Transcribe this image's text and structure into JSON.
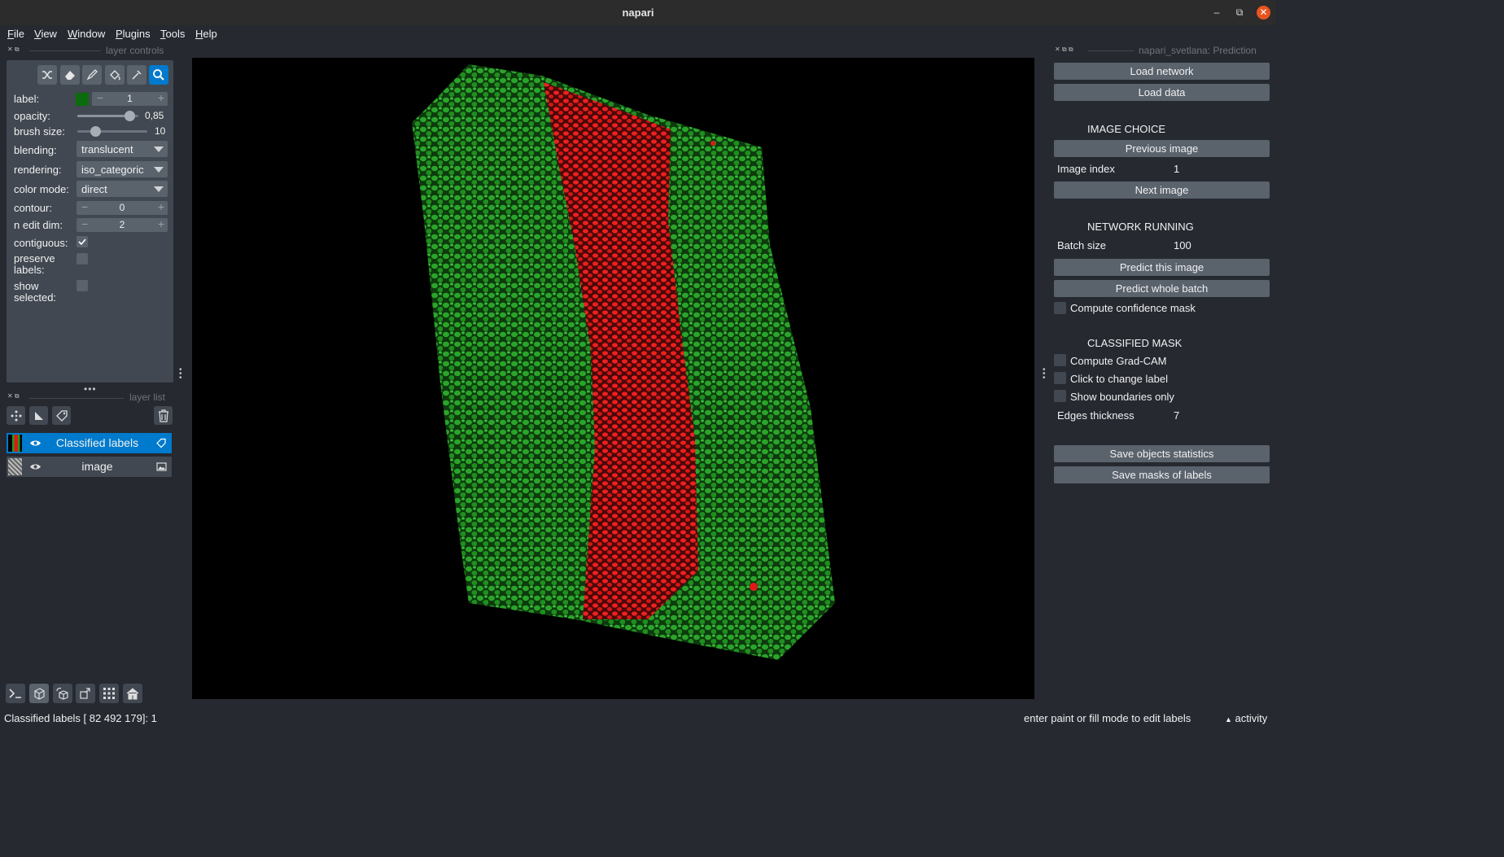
{
  "window": {
    "title": "napari"
  },
  "menu": [
    "File",
    "View",
    "Window",
    "Plugins",
    "Tools",
    "Help"
  ],
  "left_dock": {
    "controls_header": "layer controls",
    "list_header": "layer list"
  },
  "layer_controls": {
    "label_text": "label:",
    "label_value": "1",
    "label_color": "#0c6b0c",
    "opacity_text": "opacity:",
    "opacity_value": "0,85",
    "opacity_level": 0.85,
    "brush_text": "brush size:",
    "brush_value": "10",
    "blending_text": "blending:",
    "blending_value": "translucent",
    "rendering_text": "rendering:",
    "rendering_value": "iso_categoric",
    "color_mode_text": "color mode:",
    "color_mode_value": "direct",
    "contour_text": "contour:",
    "contour_value": "0",
    "n_edit_dim_text": "n edit dim:",
    "n_edit_dim_value": "2",
    "contiguous_text": "contiguous:",
    "contiguous_checked": true,
    "preserve_text_1": "preserve",
    "preserve_text_2": "labels:",
    "show_text_1": "show",
    "show_text_2": "selected:"
  },
  "layers": [
    {
      "name": "Classified labels",
      "selected": true,
      "icon": "label-tag-icon"
    },
    {
      "name": "image",
      "selected": false,
      "icon": "image-icon"
    }
  ],
  "right_dock": {
    "header": "napari_svetlana: Prediction",
    "load_network": "Load network",
    "load_data": "Load data",
    "image_choice": "IMAGE CHOICE",
    "previous_image": "Previous image",
    "image_index_label": "Image index",
    "image_index_value": "1",
    "next_image": "Next image",
    "network_running": "NETWORK RUNNING",
    "batch_size_label": "Batch size",
    "batch_size_value": "100",
    "predict_image": "Predict this image",
    "predict_batch": "Predict whole batch",
    "confidence_mask": "Compute confidence mask",
    "classified_mask": "CLASSIFIED MASK",
    "grad_cam": "Compute Grad-CAM",
    "click_change": "Click to change label",
    "show_boundaries": "Show boundaries only",
    "edges_label": "Edges thickness",
    "edges_value": "7",
    "save_stats": "Save objects statistics",
    "save_masks": "Save masks of labels"
  },
  "status": {
    "left": "Classified labels [ 82 492 179]: 1",
    "right": "enter paint or fill mode to edit labels",
    "activity": "activity"
  },
  "colors": {
    "accent": "#007acc",
    "green_label": "#1f9a1f",
    "red_label": "#e01818"
  }
}
